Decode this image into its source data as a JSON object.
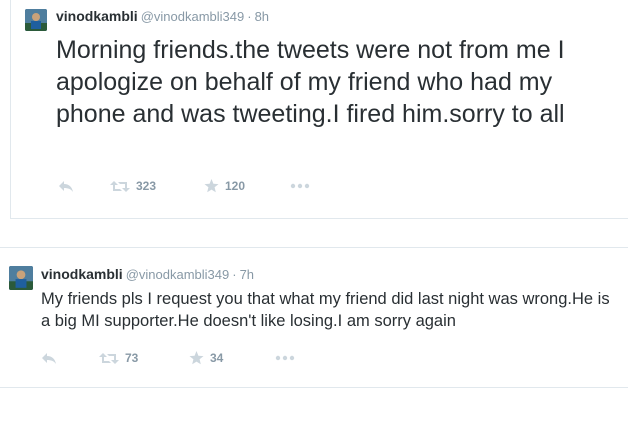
{
  "icons": {
    "reply": "reply-icon",
    "retweet": "retweet-icon",
    "favorite": "star-icon",
    "more": "more-dots-icon"
  },
  "colors": {
    "text": "#292f33",
    "meta": "#8899a6",
    "action_icon": "#ccd6dd",
    "border": "#e1e8ed"
  },
  "separator": "·",
  "tweets": [
    {
      "fullname": "vinodkambli",
      "username": "@vinodkambli349",
      "time": "8h",
      "text": "Morning friends.the tweets were not from me I apologize on behalf of my friend who had my phone and was tweeting.I fired him.sorry to all",
      "retweets": "323",
      "favorites": "120"
    },
    {
      "fullname": "vinodkambli",
      "username": "@vinodkambli349",
      "time": "7h",
      "text": "My friends pls I request you that what my friend did last night was wrong.He is a big MI supporter.He  doesn't like losing.I am sorry again",
      "retweets": "73",
      "favorites": "34"
    }
  ]
}
